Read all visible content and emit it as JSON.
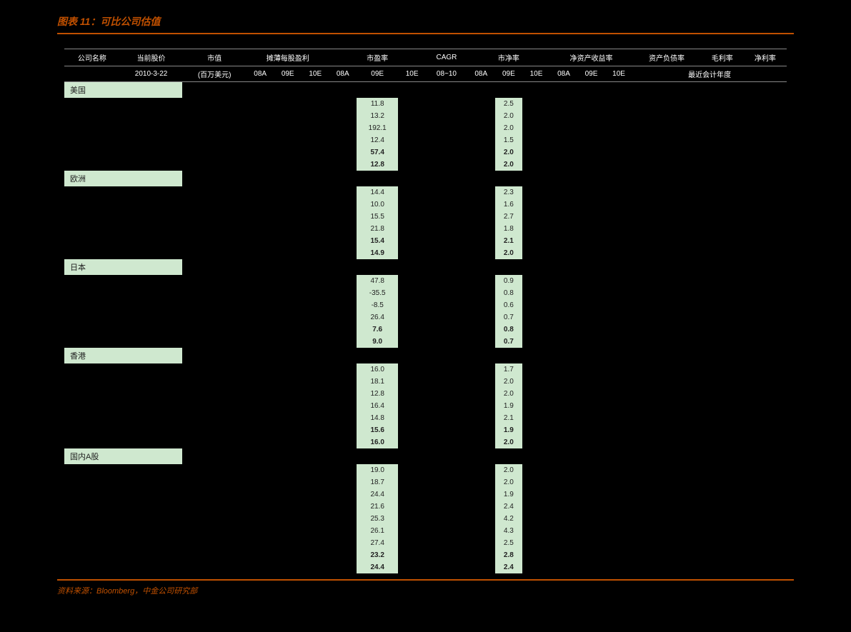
{
  "title": "图表 11：可比公司估值",
  "source": "资料来源：Bloomberg，中金公司研究部",
  "header1": {
    "company": "公司名称",
    "price": "当前股价",
    "mktcap": "市值",
    "eps": "摊薄每股盈利",
    "pe": "市盈率",
    "cagr": "CAGR",
    "pb": "市净率",
    "roe": "净资产收益率",
    "debt": "资产负债率",
    "gross": "毛利率",
    "net": "净利率"
  },
  "header2": {
    "date": "2010-3-22",
    "mktcap_unit": "(百万美元)",
    "y08a": "08A",
    "y09e": "09E",
    "y10e": "10E",
    "cagr": "08~10",
    "recent": "最近会计年度"
  },
  "regions": [
    {
      "name": "美国",
      "rows": [
        {
          "pe09e": "11.8",
          "pb09e": "2.5",
          "bold": false
        },
        {
          "pe09e": "13.2",
          "pb09e": "2.0",
          "bold": false
        },
        {
          "pe09e": "192.1",
          "pb09e": "2.0",
          "bold": false
        },
        {
          "pe09e": "12.4",
          "pb09e": "1.5",
          "bold": false
        },
        {
          "pe09e": "57.4",
          "pb09e": "2.0",
          "bold": true
        },
        {
          "pe09e": "12.8",
          "pb09e": "2.0",
          "bold": true
        }
      ]
    },
    {
      "name": "欧洲",
      "rows": [
        {
          "pe09e": "14.4",
          "pb09e": "2.3",
          "bold": false
        },
        {
          "pe09e": "10.0",
          "pb09e": "1.6",
          "bold": false
        },
        {
          "pe09e": "15.5",
          "pb09e": "2.7",
          "bold": false
        },
        {
          "pe09e": "21.8",
          "pb09e": "1.8",
          "bold": false
        },
        {
          "pe09e": "15.4",
          "pb09e": "2.1",
          "bold": true
        },
        {
          "pe09e": "14.9",
          "pb09e": "2.0",
          "bold": true
        }
      ]
    },
    {
      "name": "日本",
      "rows": [
        {
          "pe09e": "47.8",
          "pb09e": "0.9",
          "bold": false
        },
        {
          "pe09e": "-35.5",
          "pb09e": "0.8",
          "bold": false
        },
        {
          "pe09e": "-8.5",
          "pb09e": "0.6",
          "bold": false
        },
        {
          "pe09e": "26.4",
          "pb09e": "0.7",
          "bold": false
        },
        {
          "pe09e": "7.6",
          "pb09e": "0.8",
          "bold": true
        },
        {
          "pe09e": "9.0",
          "pb09e": "0.7",
          "bold": true
        }
      ]
    },
    {
      "name": "香港",
      "rows": [
        {
          "pe09e": "16.0",
          "pb09e": "1.7",
          "bold": false
        },
        {
          "pe09e": "18.1",
          "pb09e": "2.0",
          "bold": false
        },
        {
          "pe09e": "12.8",
          "pb09e": "2.0",
          "bold": false
        },
        {
          "pe09e": "16.4",
          "pb09e": "1.9",
          "bold": false
        },
        {
          "pe09e": "14.8",
          "pb09e": "2.1",
          "bold": false
        },
        {
          "pe09e": "15.6",
          "pb09e": "1.9",
          "bold": true
        },
        {
          "pe09e": "16.0",
          "pb09e": "2.0",
          "bold": true
        }
      ]
    },
    {
      "name": "国内A股",
      "rows": [
        {
          "pe09e": "19.0",
          "pb09e": "2.0",
          "bold": false
        },
        {
          "pe09e": "18.7",
          "pb09e": "2.0",
          "bold": false
        },
        {
          "pe09e": "24.4",
          "pb09e": "1.9",
          "bold": false
        },
        {
          "pe09e": "21.6",
          "pb09e": "2.4",
          "bold": false
        },
        {
          "pe09e": "25.3",
          "pb09e": "4.2",
          "bold": false
        },
        {
          "pe09e": "26.1",
          "pb09e": "4.3",
          "bold": false
        },
        {
          "pe09e": "27.4",
          "pb09e": "2.5",
          "bold": false
        },
        {
          "pe09e": "23.2",
          "pb09e": "2.8",
          "bold": true
        },
        {
          "pe09e": "24.4",
          "pb09e": "2.4",
          "bold": true
        }
      ]
    }
  ]
}
